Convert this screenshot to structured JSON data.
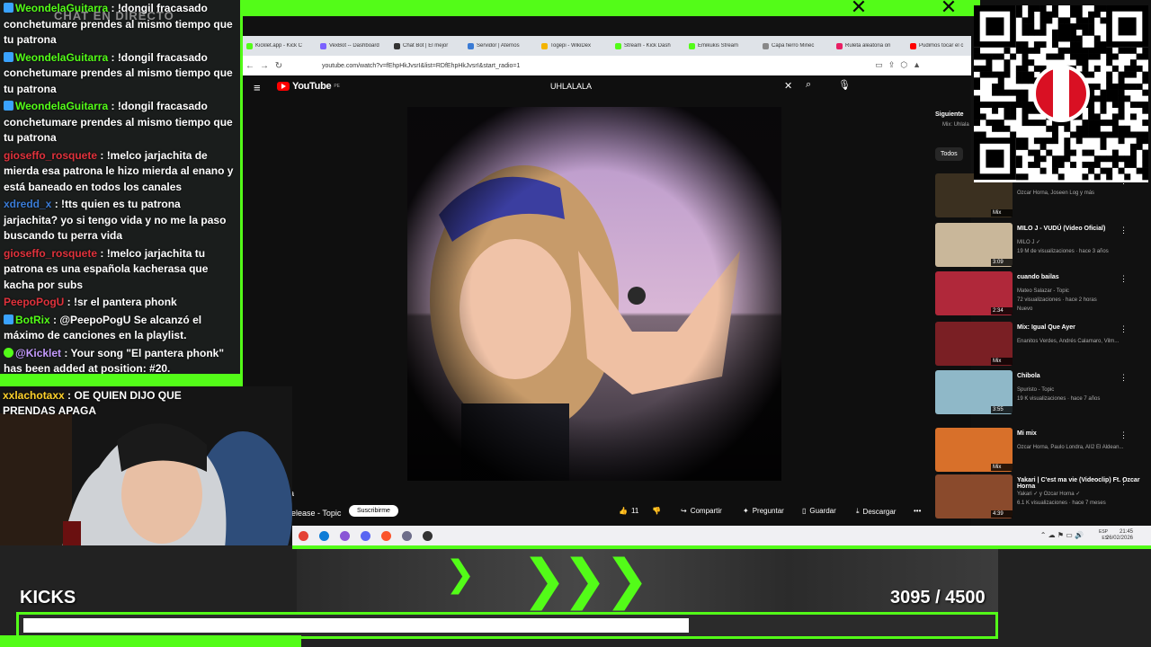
{
  "chat": {
    "header_text": "CHAT EN DIRECTO",
    "messages": [
      {
        "user": "WeondelaGuitarra",
        "user_color": "#53fc18",
        "text": "!dongil fracasado conchetumare prendes al mismo tiempo que tu patrona",
        "badge": "blue"
      },
      {
        "user": "WeondelaGuitarra",
        "user_color": "#53fc18",
        "text": "!dongil fracasado conchetumare prendes al mismo tiempo que tu patrona",
        "badge": "blue"
      },
      {
        "user": "WeondelaGuitarra",
        "user_color": "#53fc18",
        "text": "!dongil fracasado conchetumare prendes al mismo tiempo que tu patrona",
        "badge": "blue"
      },
      {
        "user": "gioseffo_rosquete",
        "user_color": "#e0323c",
        "text": "!melco jarjachita de mierda esa patrona le hizo mierda al enano y está baneado en todos los canales",
        "badge": ""
      },
      {
        "user": "xdredd_x",
        "user_color": "#3a7bd5",
        "text": "!tts quien es tu patrona jarjachita? yo si tengo vida y no me la paso buscando tu perra vida",
        "badge": ""
      },
      {
        "user": "gioseffo_rosquete",
        "user_color": "#e0323c",
        "text": "!melco jarjachita tu patrona es una española kacherasa que kacha por subs",
        "badge": ""
      },
      {
        "user": "PeepoPogU",
        "user_color": "#e0323c",
        "text": "!sr el pantera phonk",
        "badge": ""
      },
      {
        "user": "BotRix",
        "user_color": "#53fc18",
        "text": "@PeepoPogU Se alcanzó el máximo de canciones en la playlist.",
        "badge": "blue"
      },
      {
        "user": "@Kicklet",
        "user_color": "#c59bff",
        "text": "Your song \"El pantera phonk\" has been added at position: #20.",
        "badge": "green"
      },
      {
        "user": "xxlachotaxx",
        "user_color": "#ffd12b",
        "text": "OE QUIEN DIJO QUE PRENDAS APAGA",
        "badge": ""
      }
    ]
  },
  "browser": {
    "tabs": [
      {
        "label": "Kicklet.app - Kick C",
        "color": "#53fc18"
      },
      {
        "label": "VexBot -- Dashboard",
        "color": "#7b61ff"
      },
      {
        "label": "Chat Bot | El mejor",
        "color": "#333"
      },
      {
        "label": "Servidor | Aternos",
        "color": "#3a7bd5"
      },
      {
        "label": "Togepi - WikiDex",
        "color": "#f4b400"
      },
      {
        "label": "Stream - Kick Dash",
        "color": "#53fc18"
      },
      {
        "label": "Emikukis Stream",
        "color": "#53fc18"
      },
      {
        "label": "Capa fierro Minec",
        "color": "#888"
      },
      {
        "label": "Ruleta aleatoria on",
        "color": "#e91e63"
      },
      {
        "label": "Pudimos tocar el c",
        "color": "#ff0000"
      }
    ],
    "url": "youtube.com/watch?v=fEhpHkJvsrI&list=RDfEhpHkJvsrI&start_radio=1",
    "search_value": "UHLALALA",
    "logo_text": "YouTube",
    "logo_sup": "PE",
    "channel_partial": "elease - Topic",
    "channel_letter": "a",
    "subscribe_label": "Suscribirme",
    "like_count": "11",
    "share_label": "Compartir",
    "ask_label": "Preguntar",
    "save_label": "Guardar",
    "download_label": "Descargar",
    "next_label": "Siguiente",
    "mix_label": "Mix: Uhlala",
    "filter_label": "Todos",
    "recommendations": [
      {
        "title": "",
        "meta": "Ozcar Horna, Joseen Log y más",
        "dur": "Mix",
        "color": "#3b3020"
      },
      {
        "title": "MILO J - VUDÚ (Video Oficial)",
        "meta": "MILO J ✓\n19 M de visualizaciones · hace 3 años",
        "dur": "3:09",
        "color": "#c9b79a"
      },
      {
        "title": "cuando bailas",
        "meta": "Mateo Salazar - Topic\n72 visualizaciones · hace 2 horas\nNuevo",
        "dur": "2:34",
        "color": "#b0283a"
      },
      {
        "title": "Mix: Igual Que Ayer",
        "meta": "Enanitos Verdes, Andrés Calamaro, Vilm...",
        "dur": "Mix",
        "color": "#7a1f24"
      },
      {
        "title": "Chibola",
        "meta": "Spuristo - Topic\n19 K visualizaciones · hace 7 años",
        "dur": "3:55",
        "color": "#8fb8c8"
      },
      {
        "title": "Mi mix",
        "meta": "Ozcar Horna, Paulo Londra, Alí2 El Aldean...",
        "dur": "Mix",
        "color": "#d8702a"
      },
      {
        "title": "Yakari | C'est ma vie (Videoclip) Ft. Ozcar Horna",
        "meta": "Yakari ✓ y Ozcar Horna ✓\n6.1 K visualizaciones · hace 7 meses",
        "dur": "4:39",
        "color": "#8a4a2c"
      }
    ]
  },
  "taskbar": {
    "lang": "ESP\nES",
    "time": "21:45",
    "date": "26/02/2026"
  },
  "overlay": {
    "kicks_label": "KICKS",
    "goal_current": "3095",
    "goal_total": "/ 4500",
    "goal_fraction": 0.688,
    "accent": "#53fc18"
  }
}
